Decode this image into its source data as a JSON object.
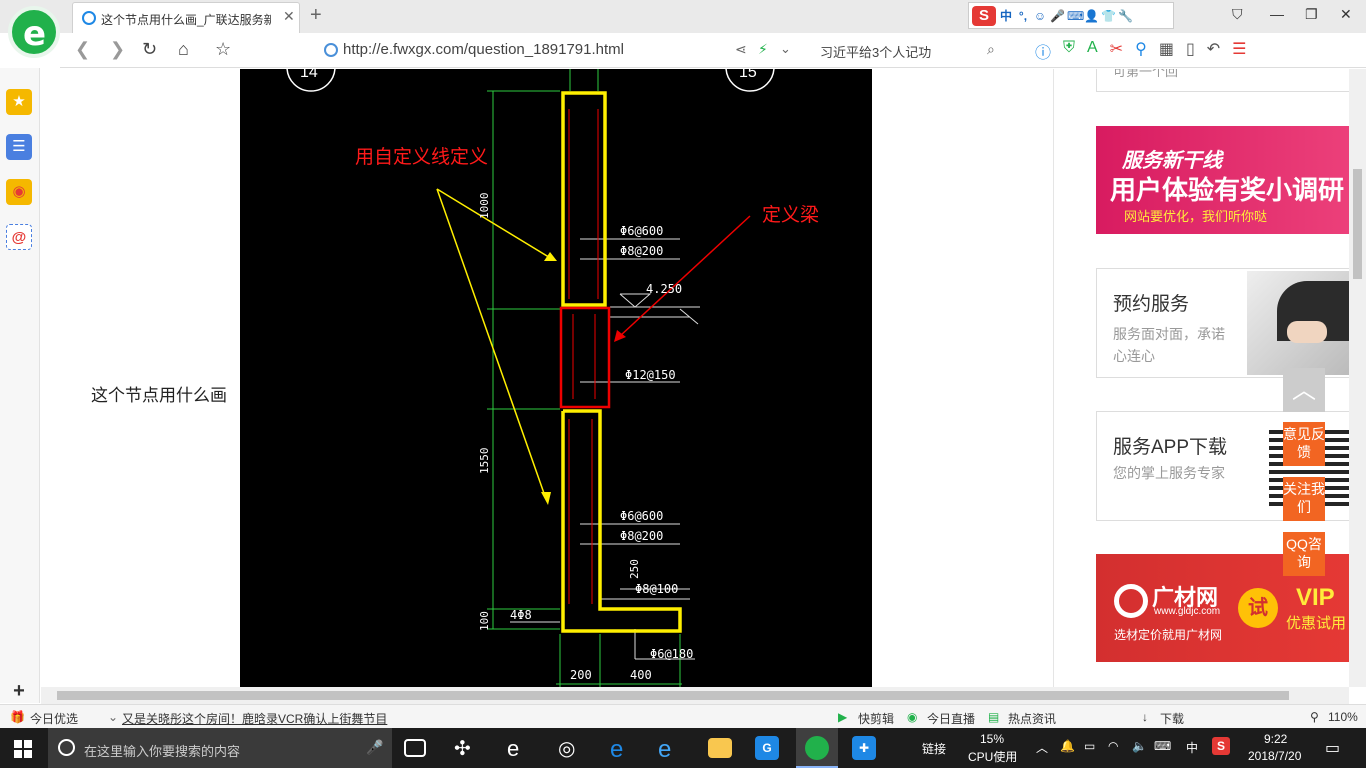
{
  "browser": {
    "tab_title": "这个节点用什么画_广联达服务新",
    "url": "http://e.fwxgx.com/question_1891791.html",
    "search_hint": "习近平给3个人记功",
    "logo_letter": "e",
    "ime_cn": "中",
    "ime_punct": "°,"
  },
  "page": {
    "question_label": "这个节点用什么画"
  },
  "cad": {
    "annotation_custom_line": "用自定义线定义",
    "annotation_beam": "定义梁",
    "axis_left": "14",
    "axis_right": "15",
    "dim_1000": "1000",
    "dim_1550": "1550",
    "dim_100": "100",
    "dim_250": "250",
    "dim_200": "200",
    "dim_400": "400",
    "elevation": "4.250",
    "rebar_top_1": "Φ6@600",
    "rebar_top_2": "Φ8@200",
    "rebar_beam": "Φ12@150",
    "rebar_mid_1": "Φ6@600",
    "rebar_mid_2": "Φ8@200",
    "rebar_bottom": "Φ8@100",
    "rebar_foot": "Φ6@180",
    "rebar_4": "4Φ8"
  },
  "ads": {
    "survey_title": "服务新干线",
    "survey_sub": "用户体验有奖小调研",
    "survey_note": "网站要优化，我们听你哒",
    "booking_title": "预约服务",
    "booking_desc": "服务面对面，承诺心连心",
    "app_title": "服务APP下载",
    "app_desc": "您的掌上服务专家",
    "gcw_brand": "广材网",
    "gcw_url": "www.gldjc.com",
    "gcw_slogan": "选材定价就用广材网",
    "gcw_try": "试",
    "gcw_vip": "VIP",
    "gcw_vip_sub": "优惠试用",
    "top_partial": "可第一个回"
  },
  "float_buttons": {
    "feedback": "意见反馈",
    "follow": "关注我们",
    "qq": "QQ咨询"
  },
  "statusbar": {
    "today": "今日优选",
    "news": "又是关晓彤这个房间！鹿晗录VCR确认上街舞节目",
    "quick_cut": "快剪辑",
    "live": "今日直播",
    "hot": "热点资讯",
    "download": "下载",
    "zoom": "110%"
  },
  "taskbar": {
    "search_placeholder": "在这里输入你要搜索的内容",
    "link": "链接",
    "cpu_percent": "15%",
    "cpu_label": "CPU使用",
    "ime": "中",
    "time": "9:22",
    "date": "2018/7/20"
  }
}
